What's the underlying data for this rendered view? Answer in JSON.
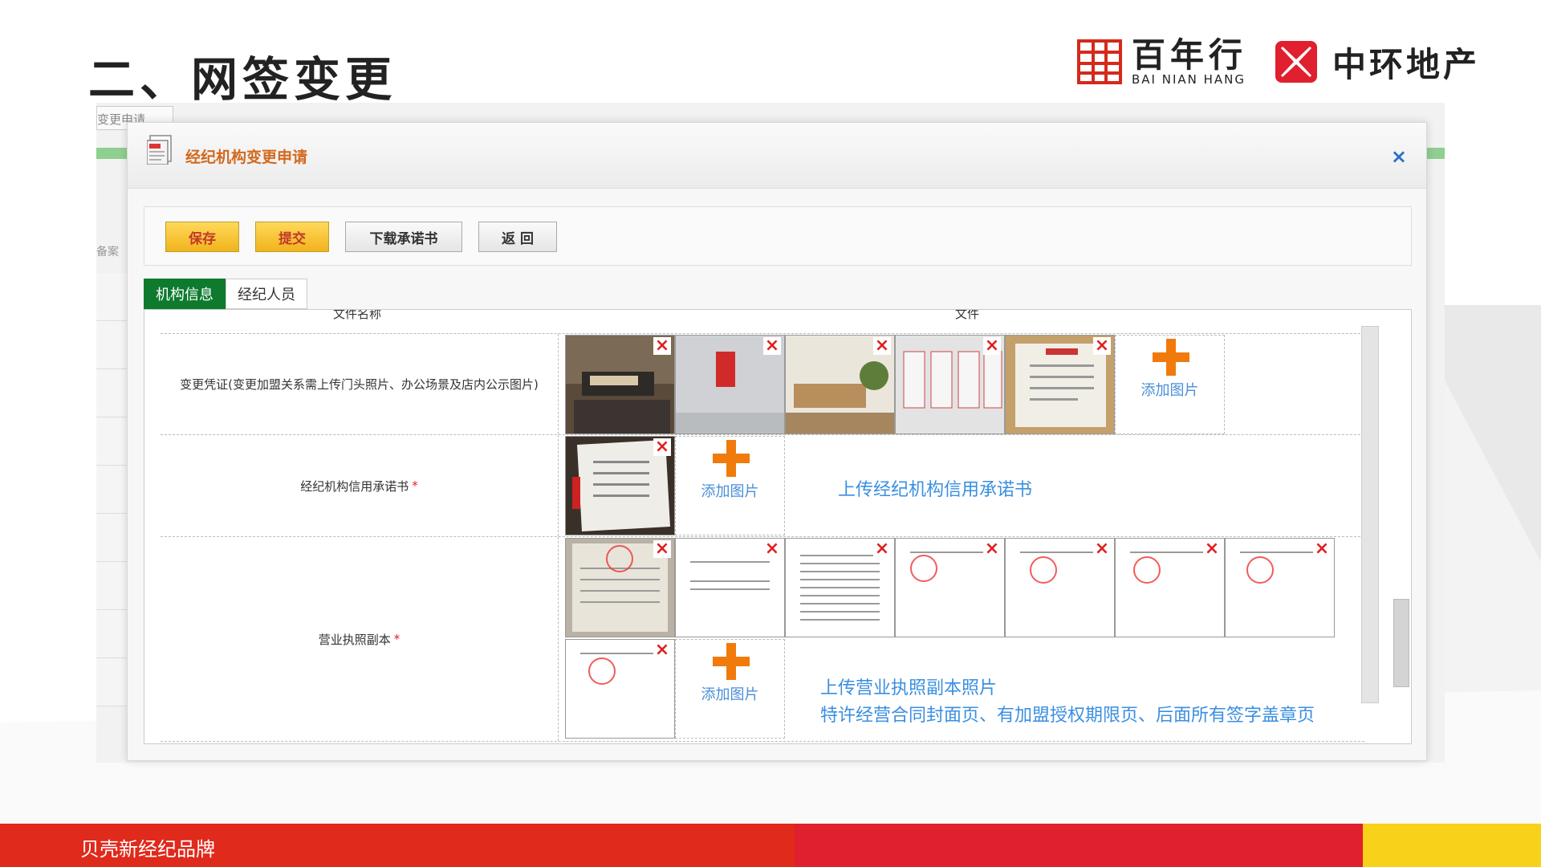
{
  "slide": {
    "title": "二、网签变更",
    "footer": "贝壳新经纪品牌"
  },
  "logos": {
    "bainianhang_cn": "百年行",
    "bainianhang_en": "BAI NIAN HANG",
    "zhonghuan_cn": "中环地产"
  },
  "background_app": {
    "tab_label": "变更申请",
    "side_text": "备案"
  },
  "modal": {
    "title": "经纪机构变更申请",
    "close": "×"
  },
  "toolbar": {
    "save": "保存",
    "submit": "提交",
    "download": "下载承诺书",
    "back": "返 回"
  },
  "tabs": [
    {
      "label": "机构信息",
      "active": true
    },
    {
      "label": "经纪人员",
      "active": false
    }
  ],
  "table": {
    "col_name": "文件名称",
    "col_file": "文件",
    "add_image": "添加图片",
    "delete": "×",
    "rows": [
      {
        "label": "变更凭证(变更加盟关系需上传门头照片、办公场景及店内公示图片)",
        "required": false,
        "hint": ""
      },
      {
        "label": "经纪机构信用承诺书",
        "required": true,
        "hint": "上传经纪机构信用承诺书"
      },
      {
        "label": "营业执照副本",
        "required": true,
        "hint": "上传营业执照副本照片",
        "hint2": "特许经营合同封面页、有加盟授权期限页、后面所有签字盖章页"
      }
    ]
  },
  "colors": {
    "tab_active": "#0e7a2e",
    "accent_orange": "#f07b0c",
    "hint_blue": "#3a8fe0",
    "footer_red": "#e02a1c",
    "footer_yellow": "#f7d11a"
  }
}
